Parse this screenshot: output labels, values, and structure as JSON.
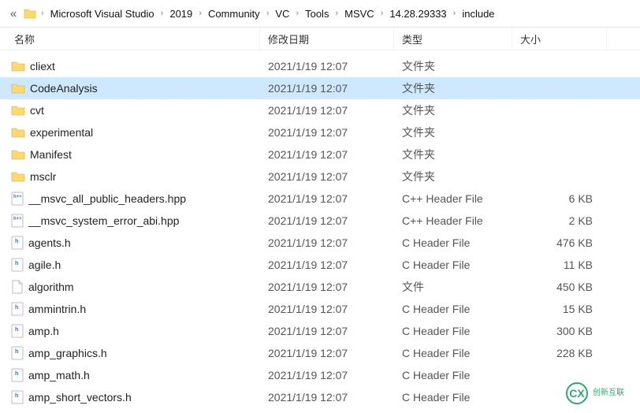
{
  "breadcrumb": {
    "back_icon": "«",
    "items": [
      "Microsoft Visual Studio",
      "2019",
      "Community",
      "VC",
      "Tools",
      "MSVC",
      "14.28.29333",
      "include"
    ]
  },
  "columns": {
    "name": "名称",
    "date": "修改日期",
    "type": "类型",
    "size": "大小"
  },
  "rows": [
    {
      "icon": "folder",
      "name": "cliext",
      "date": "2021/1/19 12:07",
      "type": "文件夹",
      "size": "",
      "selected": false
    },
    {
      "icon": "folder",
      "name": "CodeAnalysis",
      "date": "2021/1/19 12:07",
      "type": "文件夹",
      "size": "",
      "selected": true
    },
    {
      "icon": "folder",
      "name": "cvt",
      "date": "2021/1/19 12:07",
      "type": "文件夹",
      "size": "",
      "selected": false
    },
    {
      "icon": "folder",
      "name": "experimental",
      "date": "2021/1/19 12:07",
      "type": "文件夹",
      "size": "",
      "selected": false
    },
    {
      "icon": "folder",
      "name": "Manifest",
      "date": "2021/1/19 12:07",
      "type": "文件夹",
      "size": "",
      "selected": false
    },
    {
      "icon": "folder",
      "name": "msclr",
      "date": "2021/1/19 12:07",
      "type": "文件夹",
      "size": "",
      "selected": false
    },
    {
      "icon": "hpp",
      "name": "__msvc_all_public_headers.hpp",
      "date": "2021/1/19 12:07",
      "type": "C++ Header File",
      "size": "6 KB",
      "selected": false
    },
    {
      "icon": "hpp",
      "name": "__msvc_system_error_abi.hpp",
      "date": "2021/1/19 12:07",
      "type": "C++ Header File",
      "size": "2 KB",
      "selected": false
    },
    {
      "icon": "h",
      "name": "agents.h",
      "date": "2021/1/19 12:07",
      "type": "C Header File",
      "size": "476 KB",
      "selected": false
    },
    {
      "icon": "h",
      "name": "agile.h",
      "date": "2021/1/19 12:07",
      "type": "C Header File",
      "size": "11 KB",
      "selected": false
    },
    {
      "icon": "file",
      "name": "algorithm",
      "date": "2021/1/19 12:07",
      "type": "文件",
      "size": "450 KB",
      "selected": false
    },
    {
      "icon": "h",
      "name": "ammintrin.h",
      "date": "2021/1/19 12:07",
      "type": "C Header File",
      "size": "15 KB",
      "selected": false
    },
    {
      "icon": "h",
      "name": "amp.h",
      "date": "2021/1/19 12:07",
      "type": "C Header File",
      "size": "300 KB",
      "selected": false
    },
    {
      "icon": "h",
      "name": "amp_graphics.h",
      "date": "2021/1/19 12:07",
      "type": "C Header File",
      "size": "228 KB",
      "selected": false
    },
    {
      "icon": "h",
      "name": "amp_math.h",
      "date": "2021/1/19 12:07",
      "type": "C Header File",
      "size": "",
      "selected": false
    },
    {
      "icon": "h",
      "name": "amp_short_vectors.h",
      "date": "2021/1/19 12:07",
      "type": "C Header File",
      "size": "",
      "selected": false
    }
  ],
  "watermark": {
    "text": "创新互联"
  }
}
